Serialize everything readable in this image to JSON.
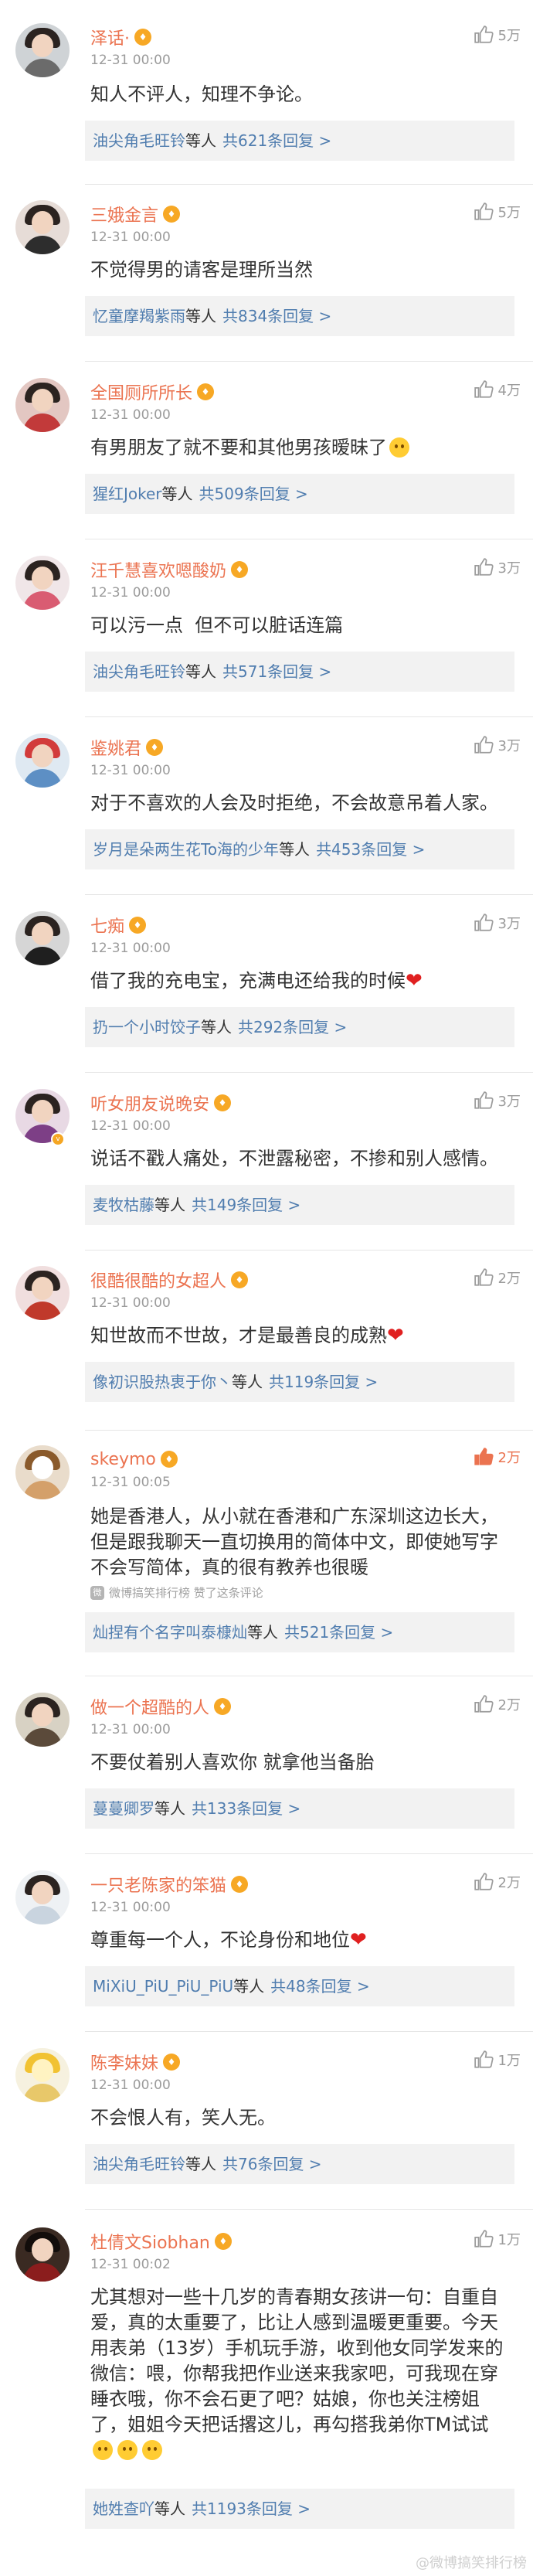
{
  "comments": [
    {
      "username": "泽话·",
      "time": "12-31 00:00",
      "likes": "5万",
      "liked": false,
      "text": "知人不评人，知理不争论。",
      "reply_names": "油尖角毛旺铃",
      "reply_suffix": "等人",
      "reply_count": "共621条回复 >"
    },
    {
      "username": "三娥金言",
      "time": "12-31 00:00",
      "likes": "5万",
      "liked": false,
      "text": "不觉得男的请客是理所当然",
      "reply_names": "忆童摩羯紫雨",
      "reply_suffix": "等人",
      "reply_count": "共834条回复 >"
    },
    {
      "username": "全国厕所所长",
      "time": "12-31 00:00",
      "likes": "4万",
      "liked": false,
      "text": "有男朋友了就不要和其他男孩暧昧了",
      "reply_names": "猩红Joker",
      "reply_suffix": "等人",
      "reply_count": "共509条回复 >"
    },
    {
      "username": "汪千慧喜欢嗯酸奶",
      "time": "12-31 00:00",
      "likes": "3万",
      "liked": false,
      "text": "可以污一点  但不可以脏话连篇",
      "reply_names": "油尖角毛旺铃",
      "reply_suffix": "等人",
      "reply_count": "共571条回复 >"
    },
    {
      "username": "鉴姚君",
      "time": "12-31 00:00",
      "likes": "3万",
      "liked": false,
      "text": "对于不喜欢的人会及时拒绝，不会故意吊着人家。",
      "reply_names": "岁月是朵两生花To海的少年",
      "reply_suffix": "等人",
      "reply_count": "共453条回复 >"
    },
    {
      "username": "七痴",
      "time": "12-31 00:00",
      "likes": "3万",
      "liked": false,
      "text": "借了我的充电宝，充满电还给我的时候",
      "reply_names": "扔一个小时饺子",
      "reply_suffix": "等人",
      "reply_count": "共292条回复 >"
    },
    {
      "username": "听女朋友说晚安",
      "time": "12-31 00:00",
      "likes": "3万",
      "liked": false,
      "text": "说话不戳人痛处，不泄露秘密，不掺和别人感情。",
      "reply_names": "麦牧枯藤",
      "reply_suffix": "等人",
      "reply_count": "共149条回复 >"
    },
    {
      "username": "很酷很酷的女超人",
      "time": "12-31 00:00",
      "likes": "2万",
      "liked": false,
      "text": "知世故而不世故，才是最善良的成熟",
      "reply_names": "像初识股热衷于你丶",
      "reply_suffix": "等人",
      "reply_count": "共119条回复 >"
    },
    {
      "username": "skeymo",
      "time": "12-31 00:05",
      "likes": "2万",
      "liked": true,
      "text": "她是香港人，从小就在香港和广东深圳这边长大，但是跟我聊天一直切换用的简体中文，即使她写字不会写简体，真的很有教养也很暖",
      "attrib": "微博搞笑排行榜 赞了这条评论",
      "reply_names": "灿捏有个名字叫泰槺灿",
      "reply_suffix": "等人",
      "reply_count": "共521条回复 >"
    },
    {
      "username": "做一个超酷的人",
      "time": "12-31 00:00",
      "likes": "2万",
      "liked": false,
      "text": "不要仗着别人喜欢你 就拿他当备胎",
      "reply_names": "蔓蔓卿罗",
      "reply_suffix": "等人",
      "reply_count": "共133条回复 >"
    },
    {
      "username": "一只老陈家的笨猫",
      "time": "12-31 00:00",
      "likes": "2万",
      "liked": false,
      "text": "尊重每一个人，不论身份和地位",
      "reply_names": "MiXiU_PiU_PiU_PiU",
      "reply_suffix": "等人",
      "reply_count": "共48条回复 >"
    },
    {
      "username": "陈李妹妹",
      "time": "12-31 00:00",
      "likes": "1万",
      "liked": false,
      "text": "不会恨人有，笑人无。",
      "reply_names": "油尖角毛旺铃",
      "reply_suffix": "等人",
      "reply_count": "共76条回复 >"
    },
    {
      "username": "杜倩文Siobhan",
      "time": "12-31 00:02",
      "likes": "1万",
      "liked": false,
      "text": "尤其想对一些十几岁的青春期女孩讲一句：自重自爱，真的太重要了，比让人感到温暖更重要。今天用表弟（13岁）手机玩手游，收到他女同学发来的微信：喂，你帮我把作业送来我家吧，可我现在穿睡衣哦，你不会石更了吧？姑娘，你也关注榜姐了，姐姐今天把话撂这儿，再勾搭我弟你TM试试",
      "reply_names": "她姓查吖",
      "reply_suffix": "等人",
      "reply_count": "共1193条回复 >"
    }
  ],
  "watermark": "@微博搞笑排行榜"
}
